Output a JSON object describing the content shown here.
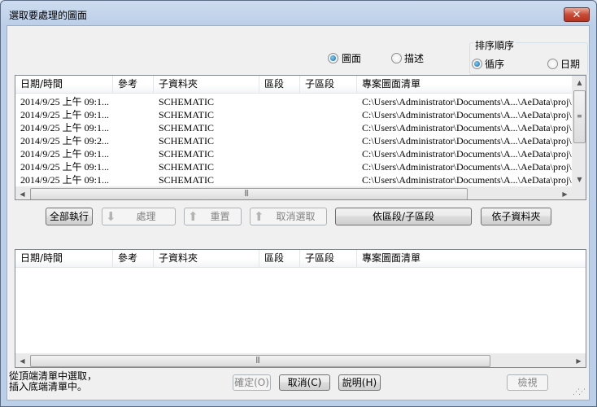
{
  "window": {
    "title": "選取要處理的圖面",
    "close_icon": "close-icon"
  },
  "view_toggle": {
    "drawing_label": "圖面",
    "description_label": "描述",
    "selected": "drawing"
  },
  "sort": {
    "group_label": "排序順序",
    "order_label": "循序",
    "date_label": "日期",
    "selected": "order"
  },
  "columns": [
    "日期/時間",
    "參考",
    "子資料夾",
    "區段",
    "子區段",
    "專案圖面清單"
  ],
  "top_list": {
    "rows": [
      {
        "date": "2014/9/25 上午 09:1...",
        "ref": "",
        "folder": "SCHEMATIC",
        "section": "",
        "subsection": "",
        "path": "C:\\Users\\Administrator\\Documents\\A...\\AeData\\proj\\De"
      },
      {
        "date": "2014/9/25 上午 09:1...",
        "ref": "",
        "folder": "SCHEMATIC",
        "section": "",
        "subsection": "",
        "path": "C:\\Users\\Administrator\\Documents\\A...\\AeData\\proj\\De"
      },
      {
        "date": "2014/9/25 上午 09:1...",
        "ref": "",
        "folder": "SCHEMATIC",
        "section": "",
        "subsection": "",
        "path": "C:\\Users\\Administrator\\Documents\\A...\\AeData\\proj\\De"
      },
      {
        "date": "2014/9/25 上午 09:2...",
        "ref": "",
        "folder": "SCHEMATIC",
        "section": "",
        "subsection": "",
        "path": "C:\\Users\\Administrator\\Documents\\A...\\AeData\\proj\\De"
      },
      {
        "date": "2014/9/25 上午 09:1...",
        "ref": "",
        "folder": "SCHEMATIC",
        "section": "",
        "subsection": "",
        "path": "C:\\Users\\Administrator\\Documents\\A...\\AeData\\proj\\De"
      },
      {
        "date": "2014/9/25 上午 09:1...",
        "ref": "",
        "folder": "SCHEMATIC",
        "section": "",
        "subsection": "",
        "path": "C:\\Users\\Administrator\\Documents\\A...\\AeData\\proj\\De"
      },
      {
        "date": "2014/9/25 上午 09:1...",
        "ref": "",
        "folder": "SCHEMATIC",
        "section": "",
        "subsection": "",
        "path": "C:\\Users\\Administrator\\Documents\\A...\\AeData\\proj\\De"
      }
    ]
  },
  "buttons": {
    "do_all": "全部執行",
    "process": "處理",
    "reset": "重置",
    "deselect": "取消選取",
    "by_section": "依區段/子區段",
    "by_subfolder": "依子資料夾",
    "ok": "確定(O)",
    "cancel": "取消(C)",
    "help": "說明(H)",
    "view": "檢視"
  },
  "status": {
    "line1": "從頂端清單中選取，",
    "line2": "插入底端清單中。"
  },
  "colors": {
    "titlebar": "#bccfe8",
    "close": "#c94a35",
    "client": "#f0f0f0",
    "radio_dot": "#1a5fa0"
  }
}
